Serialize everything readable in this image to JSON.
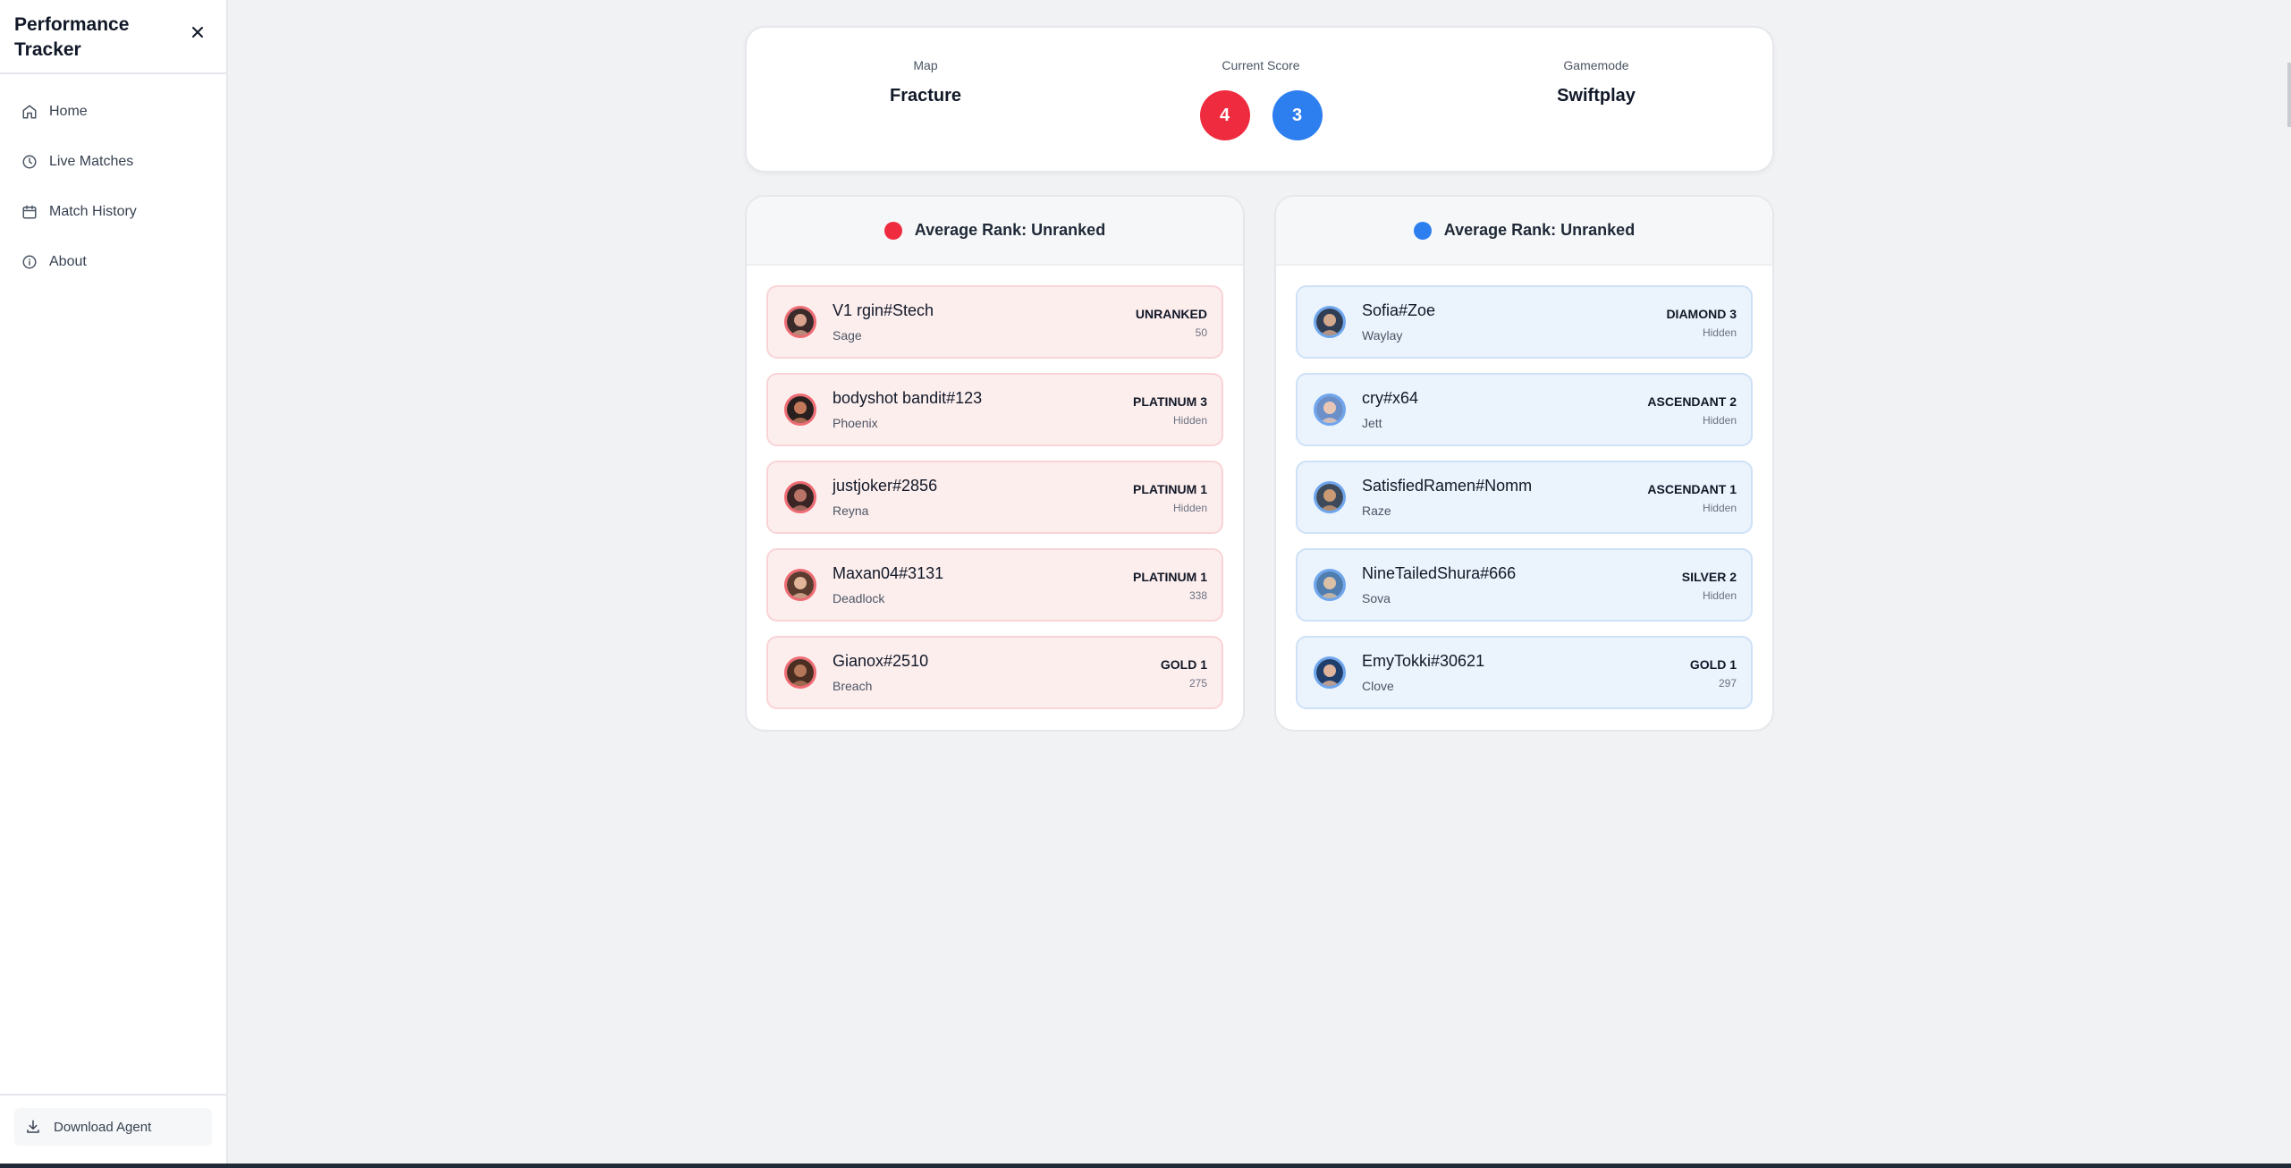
{
  "sidebar": {
    "brand": "Performance Tracker",
    "nav": [
      {
        "label": "Home",
        "icon": "home-icon"
      },
      {
        "label": "Live Matches",
        "icon": "clock-icon"
      },
      {
        "label": "Match History",
        "icon": "calendar-icon"
      },
      {
        "label": "About",
        "icon": "info-icon"
      }
    ],
    "download_label": "Download Agent"
  },
  "match": {
    "map_label": "Map",
    "map_value": "Fracture",
    "score_label": "Current Score",
    "score_red": "4",
    "score_blue": "3",
    "mode_label": "Gamemode",
    "mode_value": "Swiftplay"
  },
  "teams": [
    {
      "color": "#ef2b3f",
      "average_rank": "Average Rank: Unranked",
      "players": [
        {
          "name": "V1 rgin#Stech",
          "agent": "Sage",
          "rank": "UNRANKED",
          "rr": "50"
        },
        {
          "name": "bodyshot bandit#123",
          "agent": "Phoenix",
          "rank": "PLATINUM 3",
          "rr": "Hidden"
        },
        {
          "name": "justjoker#2856",
          "agent": "Reyna",
          "rank": "PLATINUM 1",
          "rr": "Hidden"
        },
        {
          "name": "Maxan04#3131",
          "agent": "Deadlock",
          "rank": "PLATINUM 1",
          "rr": "338"
        },
        {
          "name": "Gianox#2510",
          "agent": "Breach",
          "rank": "GOLD 1",
          "rr": "275"
        }
      ]
    },
    {
      "color": "#2d7ff0",
      "average_rank": "Average Rank: Unranked",
      "players": [
        {
          "name": "Sofia#Zoe",
          "agent": "Waylay",
          "rank": "DIAMOND 3",
          "rr": "Hidden"
        },
        {
          "name": "cry#x64",
          "agent": "Jett",
          "rank": "ASCENDANT 2",
          "rr": "Hidden"
        },
        {
          "name": "SatisfiedRamen#Nomm",
          "agent": "Raze",
          "rank": "ASCENDANT 1",
          "rr": "Hidden"
        },
        {
          "name": "NineTailedShura#666",
          "agent": "Sova",
          "rank": "SILVER 2",
          "rr": "Hidden"
        },
        {
          "name": "EmyTokki#30621",
          "agent": "Clove",
          "rank": "GOLD 1",
          "rr": "297"
        }
      ]
    }
  ]
}
